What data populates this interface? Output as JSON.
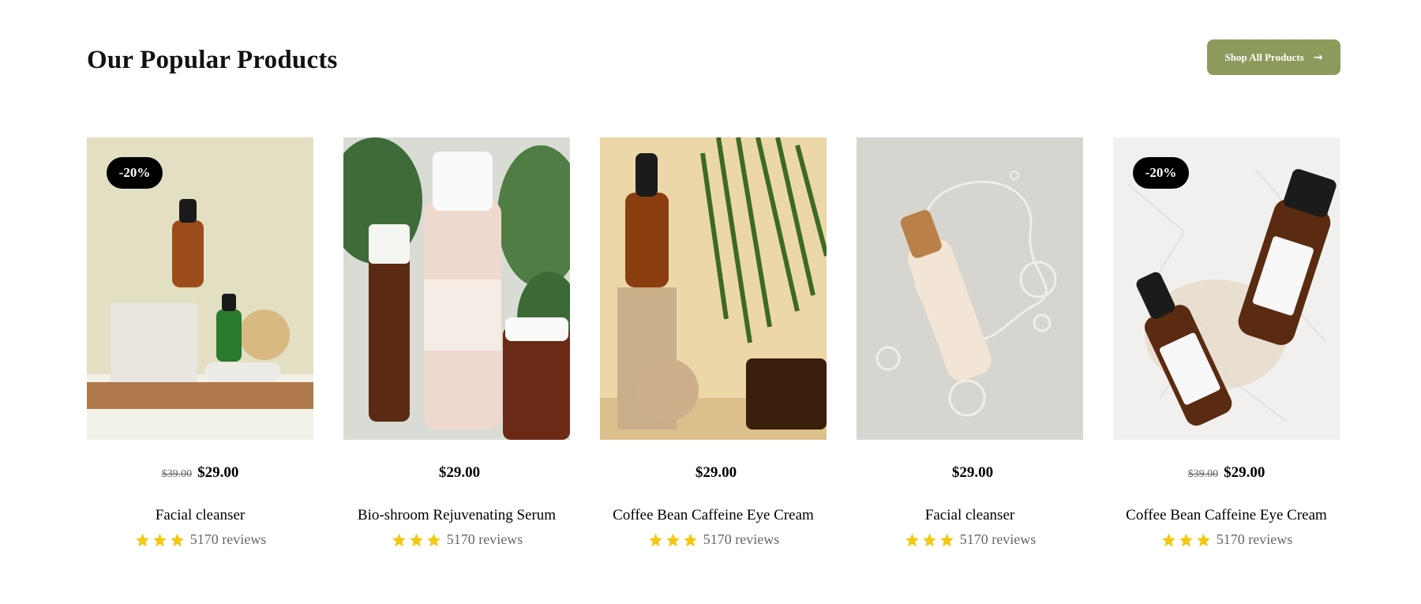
{
  "header": {
    "title": "Our Popular Products",
    "shop_button": "Shop All Products",
    "shop_button_icon": "arrow-right-icon"
  },
  "colors": {
    "accent": "#8c9a5c",
    "badge_bg": "#000000",
    "star": "#f2c811"
  },
  "products": [
    {
      "badge": "-20%",
      "old_price": "$39.00",
      "price": "$29.00",
      "name": "Facial cleanser",
      "stars": 3,
      "reviews": "5170 reviews",
      "image": "amber dropper bottles on stone podium"
    },
    {
      "badge": "",
      "old_price": "",
      "price": "$29.00",
      "name": "Bio-shroom Rejuvenating Serum",
      "stars": 3,
      "reviews": "5170 reviews",
      "image": "One Love skincare bottles with plants"
    },
    {
      "badge": "",
      "old_price": "",
      "price": "$29.00",
      "name": "Coffee Bean Caffeine Eye Cream",
      "stars": 3,
      "reviews": "5170 reviews",
      "image": "dropper bottle on wooden stand with palm leaves"
    },
    {
      "badge": "",
      "old_price": "",
      "price": "$29.00",
      "name": "Facial cleanser",
      "stars": 3,
      "reviews": "5170 reviews",
      "image": "cream bottle on grey with water drops"
    },
    {
      "badge": "-20%",
      "old_price": "$39.00",
      "price": "$29.00",
      "name": "Coffee Bean Caffeine Eye Cream",
      "stars": 3,
      "reviews": "5170 reviews",
      "image": "amber bottles on crumpled white paper"
    }
  ]
}
